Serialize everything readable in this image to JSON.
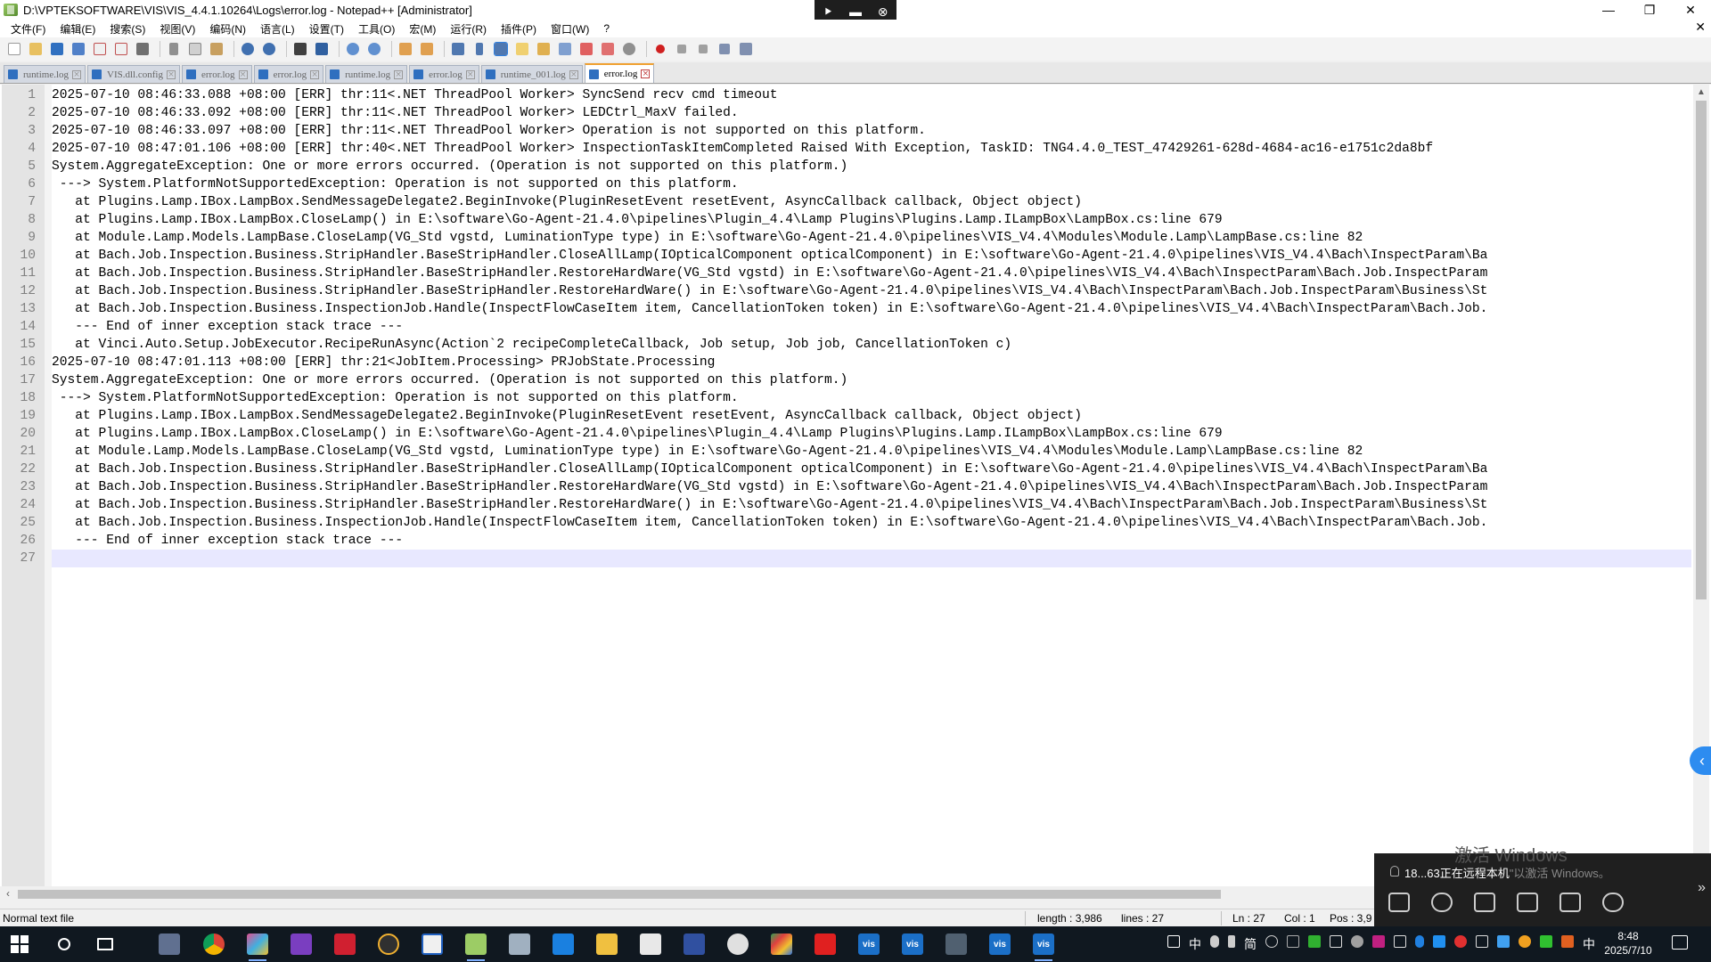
{
  "window": {
    "title": "D:\\VPTEKSOFTWARE\\VIS\\VIS_4.4.1.10264\\Logs\\error.log - Notepad++ [Administrator]",
    "min_glyph": "—",
    "max_glyph": "❐",
    "close_glyph": "✕"
  },
  "remote_bar": {
    "pin": "⯈",
    "minimize": "▬",
    "close": "⊗"
  },
  "menu": {
    "items": [
      "文件(F)",
      "编辑(E)",
      "搜索(S)",
      "视图(V)",
      "编码(N)",
      "语言(L)",
      "设置(T)",
      "工具(O)",
      "宏(M)",
      "运行(R)",
      "插件(P)",
      "窗口(W)",
      "?"
    ],
    "close_glyph": "✕"
  },
  "tabs": [
    {
      "label": "runtime.log",
      "active": false
    },
    {
      "label": "VIS.dll.config",
      "active": false
    },
    {
      "label": "error.log",
      "active": false
    },
    {
      "label": "error.log",
      "active": false
    },
    {
      "label": "runtime.log",
      "active": false
    },
    {
      "label": "error.log",
      "active": false
    },
    {
      "label": "runtime_001.log",
      "active": false
    },
    {
      "label": "error.log",
      "active": true
    }
  ],
  "editor": {
    "current_line": 27,
    "lines": [
      "2025-07-10 08:46:33.088 +08:00 [ERR] thr:11<.NET ThreadPool Worker> SyncSend recv cmd timeout",
      "2025-07-10 08:46:33.092 +08:00 [ERR] thr:11<.NET ThreadPool Worker> LEDCtrl_MaxV failed.",
      "2025-07-10 08:46:33.097 +08:00 [ERR] thr:11<.NET ThreadPool Worker> Operation is not supported on this platform.",
      "2025-07-10 08:47:01.106 +08:00 [ERR] thr:40<.NET ThreadPool Worker> InspectionTaskItemCompleted Raised With Exception, TaskID: TNG4.4.0_TEST_47429261-628d-4684-ac16-e1751c2da8bf",
      "System.AggregateException: One or more errors occurred. (Operation is not supported on this platform.)",
      " ---> System.PlatformNotSupportedException: Operation is not supported on this platform.",
      "   at Plugins.Lamp.IBox.LampBox.SendMessageDelegate2.BeginInvoke(PluginResetEvent resetEvent, AsyncCallback callback, Object object)",
      "   at Plugins.Lamp.IBox.LampBox.CloseLamp() in E:\\software\\Go-Agent-21.4.0\\pipelines\\Plugin_4.4\\Lamp Plugins\\Plugins.Lamp.ILampBox\\LampBox.cs:line 679",
      "   at Module.Lamp.Models.LampBase.CloseLamp(VG_Std vgstd, LuminationType type) in E:\\software\\Go-Agent-21.4.0\\pipelines\\VIS_V4.4\\Modules\\Module.Lamp\\LampBase.cs:line 82",
      "   at Bach.Job.Inspection.Business.StripHandler.BaseStripHandler.CloseAllLamp(IOpticalComponent opticalComponent) in E:\\software\\Go-Agent-21.4.0\\pipelines\\VIS_V4.4\\Bach\\InspectParam\\Ba",
      "   at Bach.Job.Inspection.Business.StripHandler.BaseStripHandler.RestoreHardWare(VG_Std vgstd) in E:\\software\\Go-Agent-21.4.0\\pipelines\\VIS_V4.4\\Bach\\InspectParam\\Bach.Job.InspectParam",
      "   at Bach.Job.Inspection.Business.StripHandler.BaseStripHandler.RestoreHardWare() in E:\\software\\Go-Agent-21.4.0\\pipelines\\VIS_V4.4\\Bach\\InspectParam\\Bach.Job.InspectParam\\Business\\St",
      "   at Bach.Job.Inspection.Business.InspectionJob.Handle(InspectFlowCaseItem item, CancellationToken token) in E:\\software\\Go-Agent-21.4.0\\pipelines\\VIS_V4.4\\Bach\\InspectParam\\Bach.Job.",
      "   --- End of inner exception stack trace ---",
      "   at Vinci.Auto.Setup.JobExecutor.RecipeRunAsync(Action`2 recipeCompleteCallback, Job setup, Job job, CancellationToken c)",
      "2025-07-10 08:47:01.113 +08:00 [ERR] thr:21<JobItem.Processing> PRJobState.Processing",
      "System.AggregateException: One or more errors occurred. (Operation is not supported on this platform.)",
      " ---> System.PlatformNotSupportedException: Operation is not supported on this platform.",
      "   at Plugins.Lamp.IBox.LampBox.SendMessageDelegate2.BeginInvoke(PluginResetEvent resetEvent, AsyncCallback callback, Object object)",
      "   at Plugins.Lamp.IBox.LampBox.CloseLamp() in E:\\software\\Go-Agent-21.4.0\\pipelines\\Plugin_4.4\\Lamp Plugins\\Plugins.Lamp.ILampBox\\LampBox.cs:line 679",
      "   at Module.Lamp.Models.LampBase.CloseLamp(VG_Std vgstd, LuminationType type) in E:\\software\\Go-Agent-21.4.0\\pipelines\\VIS_V4.4\\Modules\\Module.Lamp\\LampBase.cs:line 82",
      "   at Bach.Job.Inspection.Business.StripHandler.BaseStripHandler.CloseAllLamp(IOpticalComponent opticalComponent) in E:\\software\\Go-Agent-21.4.0\\pipelines\\VIS_V4.4\\Bach\\InspectParam\\Ba",
      "   at Bach.Job.Inspection.Business.StripHandler.BaseStripHandler.RestoreHardWare(VG_Std vgstd) in E:\\software\\Go-Agent-21.4.0\\pipelines\\VIS_V4.4\\Bach\\InspectParam\\Bach.Job.InspectParam",
      "   at Bach.Job.Inspection.Business.StripHandler.BaseStripHandler.RestoreHardWare() in E:\\software\\Go-Agent-21.4.0\\pipelines\\VIS_V4.4\\Bach\\InspectParam\\Bach.Job.InspectParam\\Business\\St",
      "   at Bach.Job.Inspection.Business.InspectionJob.Handle(InspectFlowCaseItem item, CancellationToken token) in E:\\software\\Go-Agent-21.4.0\\pipelines\\VIS_V4.4\\Bach\\InspectParam\\Bach.Job.",
      "   --- End of inner exception stack trace ---",
      ""
    ]
  },
  "statusbar": {
    "file_type": "Normal text file",
    "length": "length : 3,986",
    "lines": "lines : 27",
    "ln": "Ln : 27",
    "col": "Col : 1",
    "pos": "Pos : 3,9"
  },
  "remote_popup": {
    "watermark": "激活 Windows",
    "message": "18...63正在远程本机",
    "message_dim": "\"以激活 Windows。",
    "expand_glyph": "»"
  },
  "side_collapse_glyph": "‹",
  "taskbar": {
    "tray_text": [
      "中",
      "简"
    ],
    "clock_time": "8:48",
    "clock_date": "2025/7/10",
    "lang": "中"
  },
  "colors": {
    "current_line": "#e8e8ff",
    "active_tab_accent": "#f0a030",
    "taskbar": "#101820",
    "vis_app": "#1b6fc7"
  }
}
